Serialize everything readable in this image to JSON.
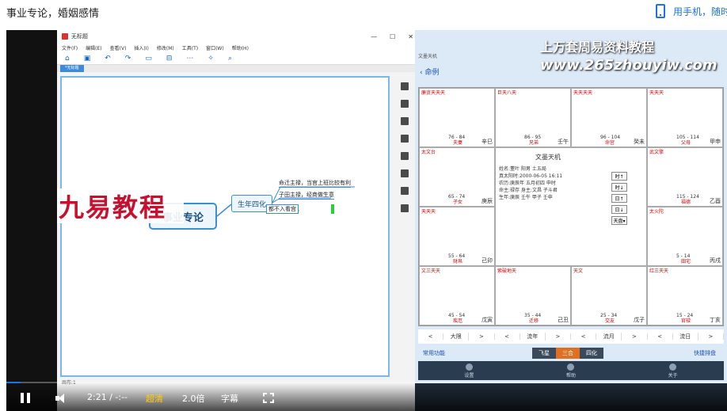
{
  "page": {
    "title": "事业专论，婚姻感情",
    "mobile_link": "用手机，随时随地看"
  },
  "left_app": {
    "window_title": "无标题",
    "menu": [
      "文件(F)",
      "编辑(E)",
      "查看(V)",
      "插入(I)",
      "修改(M)",
      "工具(T)",
      "窗口(W)",
      "帮助(H)"
    ],
    "tab": "*无标题",
    "overlay": "九易教程",
    "mindmap": {
      "main": "事业专论",
      "sub": "生年四化",
      "leaves": [
        "命迁主禄，当官上班比较有利",
        "子田主禄，经商做生意",
        "都不入看宫"
      ]
    },
    "status": "画布:1"
  },
  "right_app": {
    "watermark1": "上万套周易资料教程",
    "watermark2": "www.265zhouyiw.com",
    "subtitle": "文墨天机",
    "back_label": "命例",
    "center": {
      "title": "文墨天机",
      "lines": [
        "姓名:董叶    阳男 土五局",
        "真太阳时:2000-06-05 16:11",
        "农历:庚辰年 五月初四 申时",
        "命主:禄存 身主:文昌 子斗君",
        "生年:庚辰 壬午 甲子 壬申"
      ],
      "buttons": [
        "时↑",
        "时↓",
        "日↑",
        "日↓",
        "天盘▾"
      ]
    },
    "palaces": [
      {
        "name": "夫妻",
        "range": "76 - 84",
        "gz": "辛巳",
        "stars": "廉贪天天天"
      },
      {
        "name": "兄弟",
        "range": "86 - 95",
        "gz": "壬午",
        "stars": "巨天八天"
      },
      {
        "name": "命宫",
        "range": "96 - 104",
        "gz": "癸未",
        "stars": "天天天天"
      },
      {
        "name": "父母",
        "range": "105 - 114",
        "gz": "甲申",
        "stars": "天天天"
      },
      {
        "name": "子女",
        "range": "65 - 74",
        "gz": "庚辰",
        "stars": "太文台"
      },
      {
        "name": "福德",
        "range": "115 - 124",
        "gz": "乙酉",
        "stars": "武文擎"
      },
      {
        "name": "财帛",
        "range": "55 - 64",
        "gz": "己卯",
        "stars": "天天天"
      },
      {
        "name": "田宅",
        "range": "5 - 14",
        "gz": "丙戌",
        "stars": "太火陀"
      },
      {
        "name": "疾厄",
        "range": "45 - 54",
        "gz": "戊寅",
        "stars": "文三天天"
      },
      {
        "name": "迁移",
        "range": "35 - 44",
        "gz": "己丑",
        "stars": "紫破地天"
      },
      {
        "name": "交友",
        "range": "25 - 34",
        "gz": "戊子",
        "stars": "天文"
      },
      {
        "name": "官禄",
        "range": "15 - 24",
        "gz": "丁亥",
        "stars": "红三天天"
      }
    ],
    "controls": [
      "<",
      "大限",
      ">",
      "<",
      "流年",
      ">",
      "<",
      "流月",
      ">",
      "<",
      "流日",
      ">"
    ],
    "func_left": "常用功能",
    "func_mid": [
      "飞星",
      "三合",
      "四化"
    ],
    "func_right": "快捷排盘",
    "nav": [
      "设置",
      "帮助",
      "关于"
    ]
  },
  "player": {
    "time": "2:21 / -:--",
    "quality": "超清",
    "speed": "2.0倍",
    "subtitles": "字幕",
    "progress": 0.02
  },
  "colors": {
    "accent": "#1a73e8",
    "brand_red": "#c8102e",
    "quality": "#ffcc00"
  }
}
